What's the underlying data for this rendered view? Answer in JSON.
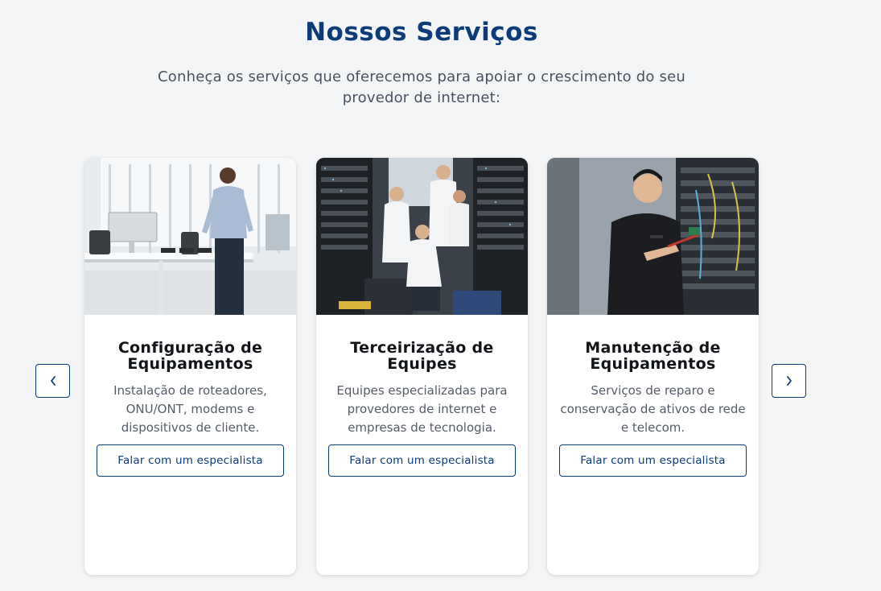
{
  "section": {
    "title": "Nossos Serviços",
    "subtitle": "Conheça os serviços que oferecemos para apoiar o crescimento do seu provedor de internet:"
  },
  "carousel": {
    "prev_icon": "chevron-left-icon",
    "next_icon": "chevron-right-icon",
    "cards": [
      {
        "title": "Configuração de Equipamentos",
        "description": "Instalação de roteadores, ONU/ONT, modems e dispositivos de cliente.",
        "button_label": "Falar com um especialista"
      },
      {
        "title": "Terceirização de Equipes",
        "description": "Equipes especializadas para provedores de internet e empresas de tecnologia.",
        "button_label": "Falar com um especialista"
      },
      {
        "title": "Manutenção de Equipamentos",
        "description": "Serviços de reparo e conservação de ativos de rede e telecom.",
        "button_label": "Falar com um especialista"
      }
    ]
  },
  "colors": {
    "brand": "#0b3b78",
    "background": "#f4f5f7",
    "card": "#ffffff"
  }
}
